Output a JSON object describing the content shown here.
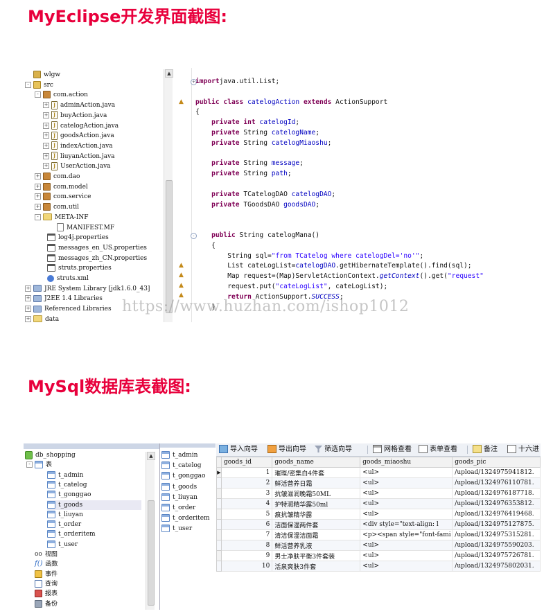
{
  "headings": {
    "eclipse": "MyEclipse开发界面截图:",
    "mysql": "MySql数据库表截图:"
  },
  "eclipse": {
    "tree": [
      {
        "label": "wlgw",
        "icon": "project-icon",
        "toggle": ""
      },
      {
        "label": "src",
        "icon": "source-folder-icon",
        "toggle": "-"
      },
      {
        "label": "com.action",
        "icon": "package-icon",
        "toggle": "-"
      },
      {
        "label": "adminAction.java",
        "icon": "java-file-icon",
        "toggle": "+"
      },
      {
        "label": "buyAction.java",
        "icon": "java-file-icon",
        "toggle": "+"
      },
      {
        "label": "catelogAction.java",
        "icon": "java-file-icon",
        "toggle": "+"
      },
      {
        "label": "goodsAction.java",
        "icon": "java-file-icon",
        "toggle": "+"
      },
      {
        "label": "indexAction.java",
        "icon": "java-file-icon",
        "toggle": "+"
      },
      {
        "label": "liuyanAction.java",
        "icon": "java-file-icon",
        "toggle": "+"
      },
      {
        "label": "UserAction.java",
        "icon": "java-file-icon",
        "toggle": "+"
      },
      {
        "label": "com.dao",
        "icon": "package-icon",
        "toggle": "+"
      },
      {
        "label": "com.model",
        "icon": "package-icon",
        "toggle": "+"
      },
      {
        "label": "com.service",
        "icon": "package-icon",
        "toggle": "+"
      },
      {
        "label": "com.util",
        "icon": "package-icon",
        "toggle": "+"
      },
      {
        "label": "META-INF",
        "icon": "folder-icon",
        "toggle": "-"
      },
      {
        "label": "MANIFEST.MF",
        "icon": "file-icon",
        "toggle": ""
      },
      {
        "label": "log4j.properties",
        "icon": "properties-icon",
        "toggle": ""
      },
      {
        "label": "messages_en_US.properties",
        "icon": "properties-icon",
        "toggle": ""
      },
      {
        "label": "messages_zh_CN.properties",
        "icon": "properties-icon",
        "toggle": ""
      },
      {
        "label": "struts.properties",
        "icon": "properties-icon",
        "toggle": ""
      },
      {
        "label": "struts.xml",
        "icon": "xml-icon",
        "toggle": ""
      },
      {
        "label": "JRE System Library [jdk1.6.0_43]",
        "icon": "library-icon",
        "toggle": "+"
      },
      {
        "label": "J2EE 1.4 Libraries",
        "icon": "library-icon",
        "toggle": "+"
      },
      {
        "label": "Referenced Libraries",
        "icon": "library-icon",
        "toggle": "+"
      },
      {
        "label": "data",
        "icon": "folder-icon",
        "toggle": "+"
      }
    ],
    "code": [
      {
        "parts": [
          [
            "kw",
            "import"
          ],
          [
            "",
            "java.util.List;"
          ]
        ]
      },
      {
        "parts": []
      },
      {
        "parts": [
          [
            "kw",
            "public class"
          ],
          [
            "fd",
            " catelogAction "
          ],
          [
            "kw",
            "extends"
          ],
          [
            "",
            " ActionSupport"
          ]
        ]
      },
      {
        "parts": [
          [
            "",
            "{"
          ]
        ]
      },
      {
        "parts": [
          [
            "",
            "    "
          ],
          [
            "kw",
            "private int"
          ],
          [
            "fd",
            " catelogId"
          ],
          [
            "",
            ";"
          ]
        ]
      },
      {
        "parts": [
          [
            "",
            "    "
          ],
          [
            "kw",
            "private"
          ],
          [
            "",
            " String "
          ],
          [
            "fd",
            "catelogName"
          ],
          [
            "",
            ";"
          ]
        ]
      },
      {
        "parts": [
          [
            "",
            "    "
          ],
          [
            "kw",
            "private"
          ],
          [
            "",
            " String "
          ],
          [
            "fd",
            "catelogMiaoshu"
          ],
          [
            "",
            ";"
          ]
        ]
      },
      {
        "parts": []
      },
      {
        "parts": [
          [
            "",
            "    "
          ],
          [
            "kw",
            "private"
          ],
          [
            "",
            " String "
          ],
          [
            "fd",
            "message"
          ],
          [
            "",
            ";"
          ]
        ]
      },
      {
        "parts": [
          [
            "",
            "    "
          ],
          [
            "kw",
            "private"
          ],
          [
            "",
            " String "
          ],
          [
            "fd",
            "path"
          ],
          [
            "",
            ";"
          ]
        ]
      },
      {
        "parts": []
      },
      {
        "parts": [
          [
            "",
            "    "
          ],
          [
            "kw",
            "private"
          ],
          [
            "",
            " TCatelogDAO "
          ],
          [
            "fd",
            "catelogDAO"
          ],
          [
            "",
            ";"
          ]
        ]
      },
      {
        "parts": [
          [
            "",
            "    "
          ],
          [
            "kw",
            "private"
          ],
          [
            "",
            " TGoodsDAO "
          ],
          [
            "fd",
            "goodsDAO"
          ],
          [
            "",
            ";"
          ]
        ]
      },
      {
        "parts": []
      },
      {
        "parts": []
      },
      {
        "parts": [
          [
            "",
            "    "
          ],
          [
            "kw",
            "public"
          ],
          [
            "",
            " String catelogMana()"
          ]
        ]
      },
      {
        "parts": [
          [
            "",
            "    {"
          ]
        ]
      },
      {
        "parts": [
          [
            "",
            "        String sql="
          ],
          [
            "st",
            "\"from TCatelog where catelogDel='no'\""
          ],
          [
            "",
            ";"
          ]
        ]
      },
      {
        "parts": [
          [
            "",
            "        List cateLogList="
          ],
          [
            "fd",
            "catelogDAO"
          ],
          [
            "",
            ".getHibernateTemplate().find(sql);"
          ]
        ]
      },
      {
        "parts": [
          [
            "",
            "        Map request=(Map)ServletActionContext."
          ],
          [
            "it",
            "getContext"
          ],
          [
            "",
            "().get("
          ],
          [
            "st",
            "\"request\""
          ]
        ]
      },
      {
        "parts": [
          [
            "",
            "        request.put("
          ],
          [
            "st",
            "\"cateLogList\""
          ],
          [
            "",
            ", cateLogList);"
          ]
        ]
      },
      {
        "parts": [
          [
            "",
            "        "
          ],
          [
            "kw",
            "return"
          ],
          [
            "",
            " ActionSupport."
          ],
          [
            "it",
            "SUCCESS"
          ],
          [
            "",
            ";"
          ]
        ]
      },
      {
        "parts": [
          [
            "",
            "    }"
          ]
        ]
      }
    ],
    "watermark": "https://www.huzhan.com/ishop1012"
  },
  "mysql": {
    "db_tree": [
      {
        "label": "db_shopping",
        "icon": "database-icon",
        "toggle": ""
      },
      {
        "label": "表",
        "icon": "table-group-icon",
        "toggle": "-"
      },
      {
        "label": "t_admin",
        "icon": "table-icon",
        "toggle": ""
      },
      {
        "label": "t_catelog",
        "icon": "table-icon",
        "toggle": ""
      },
      {
        "label": "t_gonggao",
        "icon": "table-icon",
        "toggle": ""
      },
      {
        "label": "t_goods",
        "icon": "table-icon",
        "toggle": "",
        "selected": true
      },
      {
        "label": "t_liuyan",
        "icon": "table-icon",
        "toggle": ""
      },
      {
        "label": "t_order",
        "icon": "table-icon",
        "toggle": ""
      },
      {
        "label": "t_orderitem",
        "icon": "table-icon",
        "toggle": ""
      },
      {
        "label": "t_user",
        "icon": "table-icon",
        "toggle": ""
      },
      {
        "label": "视图",
        "icon": "view-icon",
        "toggle": ""
      },
      {
        "label": "函数",
        "icon": "function-icon",
        "toggle": ""
      },
      {
        "label": "事件",
        "icon": "event-icon",
        "toggle": ""
      },
      {
        "label": "查询",
        "icon": "query-icon",
        "toggle": ""
      },
      {
        "label": "报表",
        "icon": "report-icon",
        "toggle": ""
      },
      {
        "label": "备份",
        "icon": "backup-icon",
        "toggle": ""
      }
    ],
    "table_list": [
      "t_admin",
      "t_catelog",
      "t_gonggao",
      "t_goods",
      "t_liuyan",
      "t_order",
      "t_orderitem",
      "t_user"
    ],
    "toolbar": [
      "导入向导",
      "导出向导",
      "筛选向导",
      "网格查看",
      "表单查看",
      "备注",
      "十六进"
    ],
    "columns": [
      "goods_id",
      "goods_name",
      "goods_miaoshu",
      "goods_pic"
    ],
    "rows": [
      [
        "1",
        "璀璨/密集白4件套",
        "<ul>",
        "/upload/1324975941812."
      ],
      [
        "2",
        "鲜活营养日霜",
        "<ul>",
        "/upload/1324976110781."
      ],
      [
        "3",
        "抗皱滋润晚霜50ML",
        "<ul>",
        "/upload/1324976187718."
      ],
      [
        "4",
        "护特润精华露50ml",
        "<ul>",
        "/upload/1324976353812."
      ],
      [
        "5",
        "痕抗皱精华露",
        "<ul>",
        "/upload/1324976419468."
      ],
      [
        "6",
        "洁面保湿两件套",
        "<div style=\"text-align: l",
        "/upload/1324975127875."
      ],
      [
        "7",
        "清洁保湿洁面霜",
        "<p><span style=\"font-fami",
        "/upload/1324975315281."
      ],
      [
        "8",
        "鲜活营养乳液",
        "<ul>",
        "/upload/1324975590203."
      ],
      [
        "9",
        "男士净肤平衡3件套装",
        "<ul>",
        "/upload/1324975726781."
      ],
      [
        "10",
        "活泉爽肤3件套",
        "<ul>",
        "/upload/1324975802031."
      ]
    ]
  }
}
